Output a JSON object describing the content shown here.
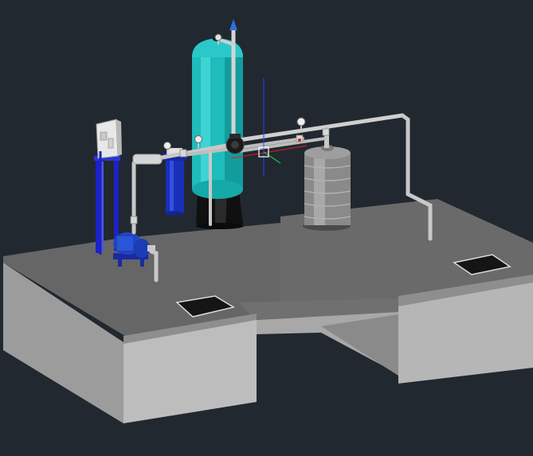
{
  "viewport": {
    "background": "#212830",
    "colors": {
      "concrete_top": "#6a6a6a",
      "concrete_side": "#9a9a9a",
      "concrete_front": "#b4b4b4",
      "concrete_shadow": "#555555",
      "filter_vessel": "#1fbcbc",
      "filter_vessel_shade": "#0f8a8a",
      "cartridge_housing": "#1a2fb8",
      "pump": "#2147c8",
      "pipe": "#c8c8c8",
      "storage_tank": "#8c8c8c",
      "panel_stand": "#1a22c8",
      "axis_x": "#e02020",
      "axis_y": "#20c040",
      "axis_z": "#3040ff",
      "grate": "#111111"
    },
    "icons": {
      "vent_arrow": "arrow-up-icon",
      "pressure_gauge": "gauge-icon",
      "ucs": "ucs-cursor-icon"
    }
  }
}
